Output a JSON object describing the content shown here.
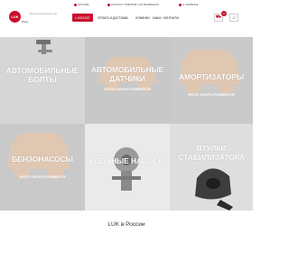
{
  "topbar": {
    "city": "МОСКВА",
    "notice": "КАТАЛОГ ТОВАРОВ LUK ВРЕМЕННО",
    "service": "О СЕРВИСЕ"
  },
  "header": {
    "logo_text": "LUK",
    "logo_sub": "Shop",
    "tagline": "Официальный магазин LUK",
    "catalog_label": "КАТАЛОГ",
    "nav": [
      "ОПЛАТА И ДОСТАВКА",
      "НОВИНКИ",
      "НАШИ",
      "КОНТАКТЫ"
    ],
    "cart_count": "0"
  },
  "tiles": [
    {
      "title": "АВТОМОБИЛЬНЫЕ БОЛТЫ",
      "placeholder": ""
    },
    {
      "title": "АВТОМОБИЛЬНЫЕ ДАТЧИКИ",
      "placeholder": "ФОТО СКОРО ПОЯВИТСЯ"
    },
    {
      "title": "АМОРТИЗАТОРЫ",
      "placeholder": "ФОТО СКОРО ПОЯВИТСЯ"
    },
    {
      "title": "БЕНЗОНАСОСЫ",
      "placeholder": "ФОТО СКОРО ПОЯВИТСЯ"
    },
    {
      "title": "ВОДЯНЫЕ НАСОСЫ",
      "placeholder": ""
    },
    {
      "title": "ВТУЛКИ СТАБИЛИЗАТОРА",
      "placeholder": ""
    }
  ],
  "section_title": "LUK в России",
  "colors": {
    "brand": "#c8102e",
    "tile_bg": "#d2d2d2"
  }
}
